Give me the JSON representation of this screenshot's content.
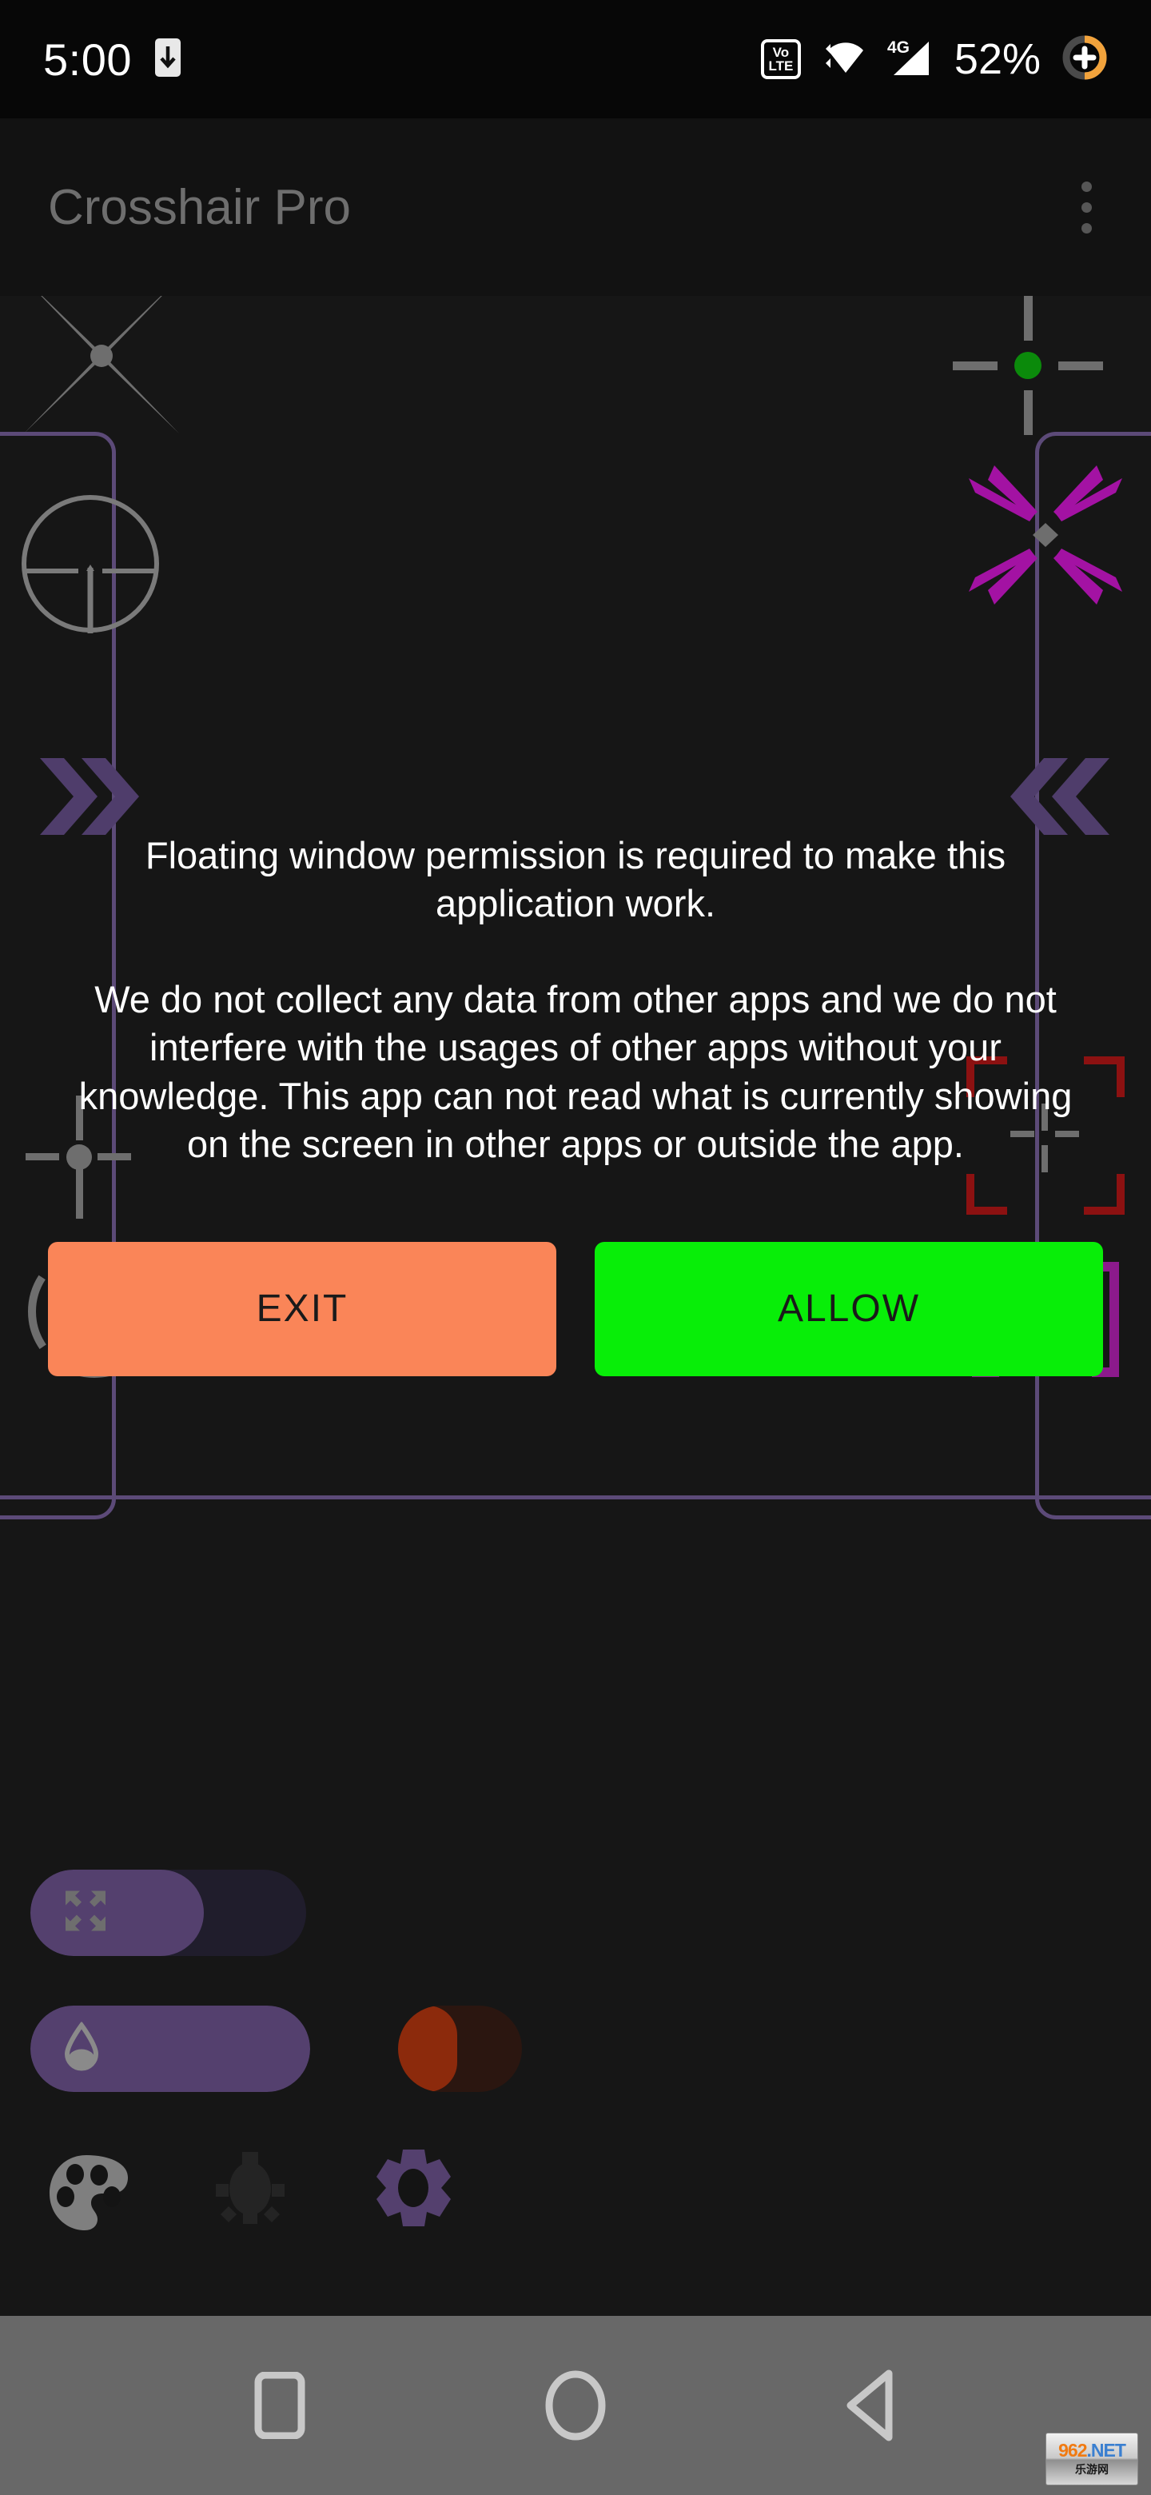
{
  "status_bar": {
    "time": "5:00",
    "left_icon": "phone-download-icon",
    "icons": [
      "volte-icon",
      "wifi-icon",
      "4g-signal-icon"
    ],
    "volte_top": "Vo",
    "volte_bottom": "LTE",
    "network_label": "4G",
    "battery_percent": "52%",
    "battery_charging_icon": "battery-charging-plus-icon",
    "battery_accent": "#f2a33c"
  },
  "app_bar": {
    "title": "Crosshair Pro",
    "overflow_icon": "overflow-menu-icon"
  },
  "preview": {
    "card_border_color": "#5c4a78",
    "crosshairs": [
      {
        "name": "x-burst-dot-crosshair",
        "color": "#6e6e6e"
      },
      {
        "name": "scope-circle-crosshair",
        "color": "#7a7a7a"
      },
      {
        "name": "chevron-right-double-icon",
        "color": "#4f3d6b"
      },
      {
        "name": "gap-cross-dot-crosshair",
        "color": "#6e6e6e"
      },
      {
        "name": "dashed-circle-dot-crosshair",
        "color": "#6e6e6e"
      },
      {
        "name": "cross-green-dot-crosshair",
        "color": "#6e6e6e",
        "dot_color": "#0b8a0b"
      },
      {
        "name": "magenta-x-burst-diamond-crosshair",
        "color": "#a312a3",
        "center_color": "#6e6e6e"
      },
      {
        "name": "chevron-left-double-icon",
        "color": "#4f3d6b"
      },
      {
        "name": "red-corner-bracket-crosshair",
        "color": "#8c1111"
      },
      {
        "name": "purple-bracket-green-dot-crosshair",
        "color": "#8c1a8c",
        "dot_color": "#0b8a0b"
      }
    ]
  },
  "dialog": {
    "paragraph_1": "Floating window permission is required to make this application work.",
    "paragraph_2": "We do not collect any data from other apps and we do not interfere with the usages of other apps without your knowledge.\nThis app can not read what is currently showing on the screen in other apps or outside the app.",
    "exit_label": "EXIT",
    "allow_label": "ALLOW",
    "exit_color": "#fa8558",
    "allow_color": "#08ee08"
  },
  "controls": {
    "size_slider": {
      "icon": "resize-expand-icon",
      "fill_percent": 63,
      "track_width": 345,
      "fill_color": "#54406e",
      "track_color": "#201d2c"
    },
    "opacity_slider": {
      "icon": "opacity-drop-icon",
      "fill_percent": 100,
      "track_width": 350,
      "fill_color": "#54406e"
    },
    "color_slider": {
      "icon": "color-swatch",
      "fill_percent": 48,
      "track_width": 155,
      "fill_color": "#8c2a0c",
      "track_color": "#2b1610"
    },
    "icon_buttons": [
      {
        "name": "palette-icon",
        "color": "#7f7f7f"
      },
      {
        "name": "brightness-bulb-icon",
        "color": "#242424"
      },
      {
        "name": "settings-gear-icon",
        "color": "#54406e"
      }
    ]
  },
  "nav_bar": {
    "background": "#686868",
    "buttons": [
      {
        "name": "recents-square-icon"
      },
      {
        "name": "home-circle-icon"
      },
      {
        "name": "back-triangle-icon"
      }
    ]
  },
  "watermark": {
    "number": "962",
    "domain": ".NET",
    "chinese": "乐游网"
  }
}
